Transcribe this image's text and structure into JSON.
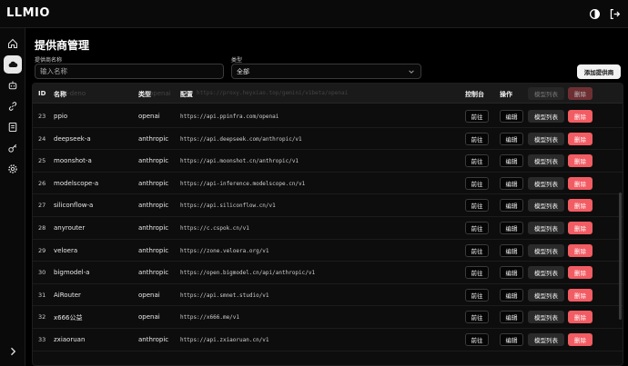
{
  "app": {
    "title": "LLMIO"
  },
  "header_icons": {
    "theme": "contrast-icon",
    "logout": "logout-icon"
  },
  "sidebar": {
    "items": [
      {
        "name": "home",
        "icon": "home-icon"
      },
      {
        "name": "providers",
        "icon": "cloud-icon"
      },
      {
        "name": "models",
        "icon": "bot-icon"
      },
      {
        "name": "links",
        "icon": "link-icon"
      },
      {
        "name": "logs",
        "icon": "list-icon"
      },
      {
        "name": "keys",
        "icon": "key-icon"
      },
      {
        "name": "settings",
        "icon": "gear-icon"
      }
    ],
    "expand_icon": "chevron-right-icon"
  },
  "page": {
    "title": "提供商管理",
    "filter_name_label": "提供商名称",
    "filter_name_placeholder": "输入名称",
    "filter_type_label": "类型",
    "filter_type_value": "全部",
    "add_button": "添加提供商"
  },
  "table": {
    "headers": {
      "id": "ID",
      "name": "名称",
      "type": "类型",
      "config": "配置",
      "console": "控制台",
      "actions": "操作"
    },
    "ghost_row": {
      "name": "mini-deno",
      "type": "openai",
      "url": "https://proxy.heyxiao.top/gemini/v1beta/openai",
      "models": "模型列表",
      "del": "删除"
    },
    "button_labels": {
      "goto": "前往",
      "edit": "编辑",
      "models": "模型列表",
      "delete": "删除"
    },
    "rows": [
      {
        "id": "23",
        "name": "ppio",
        "type": "openai",
        "url": "https://api.ppinfra.com/openai"
      },
      {
        "id": "24",
        "name": "deepseek-a",
        "type": "anthropic",
        "url": "https://api.deepseek.com/anthropic/v1"
      },
      {
        "id": "25",
        "name": "moonshot-a",
        "type": "anthropic",
        "url": "https://api.moonshot.cn/anthropic/v1"
      },
      {
        "id": "26",
        "name": "modelscope-a",
        "type": "anthropic",
        "url": "https://api-inference.modelscope.cn/v1"
      },
      {
        "id": "27",
        "name": "siliconflow-a",
        "type": "anthropic",
        "url": "https://api.siliconflow.cn/v1"
      },
      {
        "id": "28",
        "name": "anyrouter",
        "type": "anthropic",
        "url": "https://c.cspok.cn/v1"
      },
      {
        "id": "29",
        "name": "veloera",
        "type": "anthropic",
        "url": "https://zone.veloera.org/v1"
      },
      {
        "id": "30",
        "name": "bigmodel-a",
        "type": "anthropic",
        "url": "https://open.bigmodel.cn/api/anthropic/v1"
      },
      {
        "id": "31",
        "name": "AiRouter",
        "type": "openai",
        "url": "https://api.smnet.studio/v1"
      },
      {
        "id": "32",
        "name": "x666公益",
        "type": "openai",
        "url": "https://x666.me/v1"
      },
      {
        "id": "33",
        "name": "zxiaoruan",
        "type": "anthropic",
        "url": "https://api.zxiaoruan.cn/v1"
      }
    ]
  },
  "colors": {
    "delete": "#f25c63",
    "background": "#000000",
    "active_nav": "#e8e8e8"
  }
}
